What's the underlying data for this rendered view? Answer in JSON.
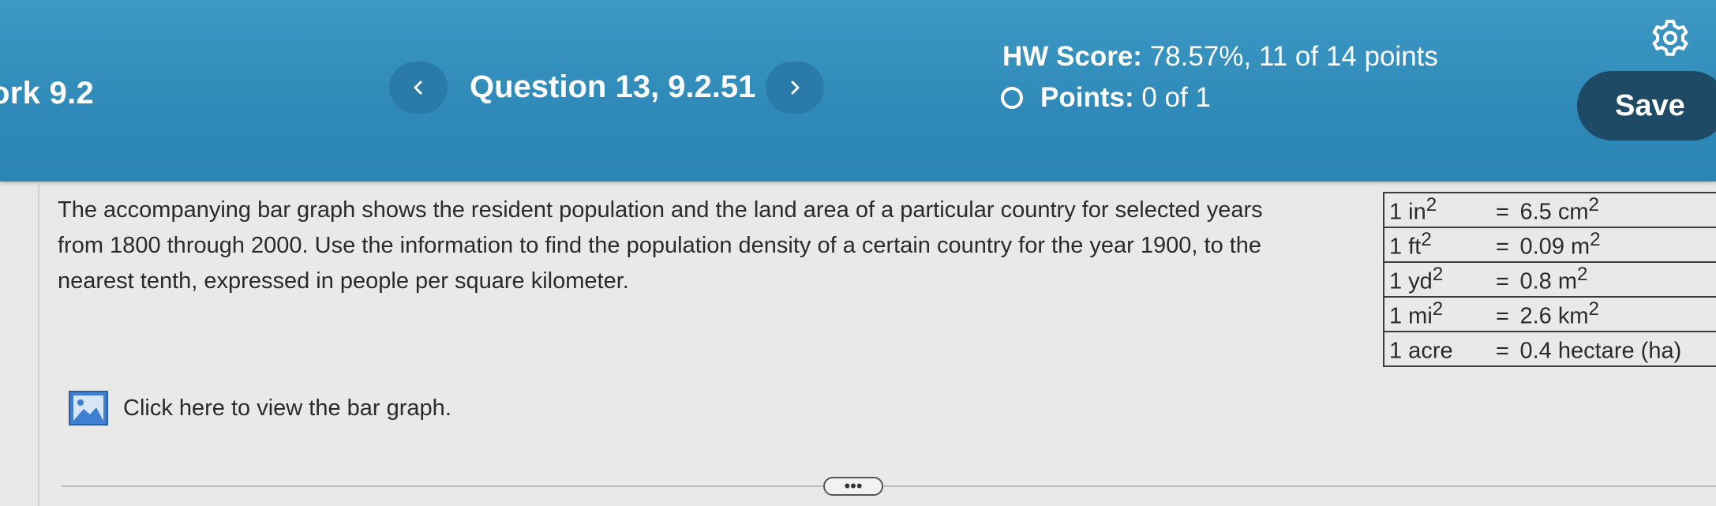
{
  "header": {
    "assignment_title": "ork 9.2",
    "question_title": "Question 13, 9.2.51",
    "hw_score_label": "HW Score:",
    "hw_score_value": "78.57%, 11 of 14 points",
    "points_label": "Points:",
    "points_value": "0 of 1",
    "save_label": "Save",
    "prev_icon": "chevron-left-icon",
    "next_icon": "chevron-right-icon",
    "settings_icon": "gear-icon",
    "colors": {
      "header_bg": "#2f8ab9",
      "save_bg": "#1e4a66",
      "nav_btn_bg": "#2a7ba7"
    }
  },
  "question": {
    "text": "The accompanying bar graph shows the resident population and the land area of a particular country for selected years from 1800 through 2000. Use the information to find the population density of a certain country for the year 1900, to the nearest tenth, expressed in people per square kilometer."
  },
  "conversions": [
    {
      "from_base": "1 in",
      "from_sup": "2",
      "eq": "=",
      "to_base": "6.5 cm",
      "to_sup": "2"
    },
    {
      "from_base": "1 ft",
      "from_sup": "2",
      "eq": "=",
      "to_base": "0.09 m",
      "to_sup": "2"
    },
    {
      "from_base": "1 yd",
      "from_sup": "2",
      "eq": "=",
      "to_base": "0.8 m",
      "to_sup": "2"
    },
    {
      "from_base": "1 mi",
      "from_sup": "2",
      "eq": "=",
      "to_base": "2.6 km",
      "to_sup": "2"
    },
    {
      "from_base": "1 acre",
      "from_sup": "",
      "eq": "=",
      "to_base": "0.4 hectare (ha)",
      "to_sup": ""
    }
  ],
  "graph_link": {
    "label": "Click here to view the bar graph.",
    "icon": "image-icon"
  },
  "more_button": {
    "label": "•••"
  }
}
